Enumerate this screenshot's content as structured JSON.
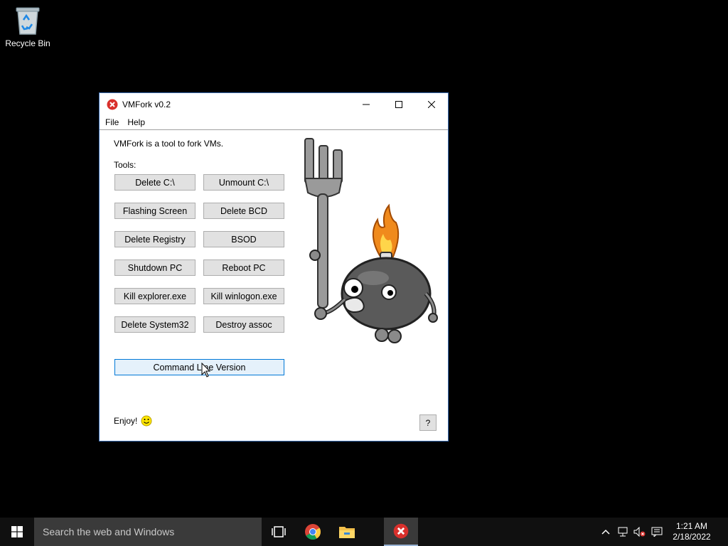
{
  "desktop": {
    "recycle_bin_label": "Recycle Bin"
  },
  "window": {
    "title": "VMFork v0.2",
    "menu": [
      "File",
      "Help"
    ],
    "intro": "VMFork is a tool to fork VMs.",
    "tools_label": "Tools:",
    "buttons": [
      [
        "Delete C:\\",
        "Unmount C:\\"
      ],
      [
        "Flashing Screen",
        "Delete BCD"
      ],
      [
        "Delete Registry",
        "BSOD"
      ],
      [
        "Shutdown PC",
        "Reboot PC"
      ],
      [
        "Kill explorer.exe",
        "Kill winlogon.exe"
      ],
      [
        "Delete System32",
        "Destroy assoc"
      ]
    ],
    "cmd_button": "Command Line Version",
    "enjoy": "Enjoy!",
    "help_button": "?"
  },
  "taskbar": {
    "search_placeholder": "Search the web and Windows",
    "time": "1:21 AM",
    "date": "2/18/2022"
  },
  "colors": {
    "accent": "#0078d7",
    "error_red": "#d9302c",
    "taskbar": "#101010"
  }
}
